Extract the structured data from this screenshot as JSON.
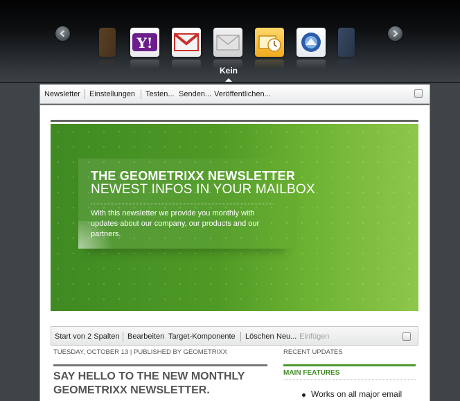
{
  "client_chooser": {
    "selected_label": "Kein",
    "clients": [
      {
        "name": "partial-client-icon",
        "color": "#7a4a1c"
      },
      {
        "name": "yahoo-mail-icon",
        "color": "#6b1e8c"
      },
      {
        "name": "gmail-icon",
        "color": "#c9302c"
      },
      {
        "name": "generic-mail-icon",
        "color": "#d8d8d8"
      },
      {
        "name": "outlook-icon",
        "color": "#f2b52f"
      },
      {
        "name": "thunderbird-icon",
        "color": "#2a5ca8"
      },
      {
        "name": "partial-client-icon",
        "color": "#3c5a8a"
      }
    ]
  },
  "toolbar": {
    "newsletter": "Newsletter",
    "settings": "Einstellungen",
    "test": "Testen...",
    "send": "Senden...",
    "publish": "Veröffentlichen..."
  },
  "hero": {
    "title_line1": "THE GEOMETRIXX NEWSLETTER",
    "title_line2": "NEWEST INFOS IN YOUR MAILBOX",
    "text": "With this newsletter we provide you monthly with updates about our company, our products and our partners."
  },
  "column_toolbar": {
    "start": "Start von 2 Spalten",
    "edit": "Bearbeiten",
    "target": "Target-Komponente",
    "delete": "Löschen",
    "new": "Neu...",
    "insert": "Einfügen"
  },
  "article": {
    "meta": "TUESDAY, OCTOBER 13 | PUBLISHED BY GEOMETRIXX",
    "headline": "SAY HELLO TO THE NEW MONTHLY GEOMETRIXX NEWSLETTER."
  },
  "sidebar": {
    "label": "RECENT UPDATES",
    "title": "MAIN FEATURES",
    "bullet": "Works on all major email"
  },
  "colors": {
    "hero_green": "#4f9a25",
    "accent_green": "#3f8a22"
  }
}
